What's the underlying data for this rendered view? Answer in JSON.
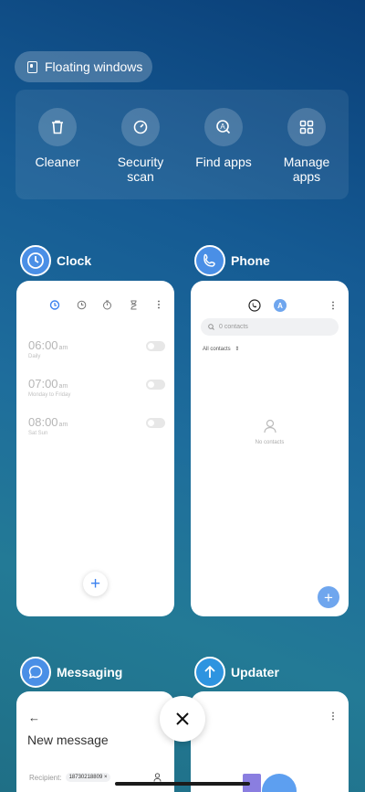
{
  "floating_windows": {
    "label": "Floating windows"
  },
  "tools": [
    {
      "label": "Cleaner",
      "icon": "trash-icon"
    },
    {
      "label": "Security\nscan",
      "icon": "security-scan-icon"
    },
    {
      "label": "Find apps",
      "icon": "find-apps-icon"
    },
    {
      "label": "Manage\napps",
      "icon": "grid-icon"
    }
  ],
  "apps": {
    "clock": {
      "name": "Clock",
      "alarms": [
        {
          "time": "06:00",
          "ampm": "am",
          "repeat": "Daily"
        },
        {
          "time": "07:00",
          "ampm": "am",
          "repeat": "Monday to Friday"
        },
        {
          "time": "08:00",
          "ampm": "am",
          "repeat": "Sat Sun"
        }
      ],
      "fab": "+"
    },
    "phone": {
      "name": "Phone",
      "search_placeholder": "0 contacts",
      "filter": "All contacts",
      "empty": "No contacts",
      "fab": "+"
    },
    "messaging": {
      "name": "Messaging",
      "title": "New message",
      "recipient_label": "Recipient:",
      "recipient_value": "18730218809"
    },
    "updater": {
      "name": "Updater"
    }
  },
  "colors": {
    "accent": "#3c82ef",
    "fab_phone": "#6fa6ee"
  }
}
